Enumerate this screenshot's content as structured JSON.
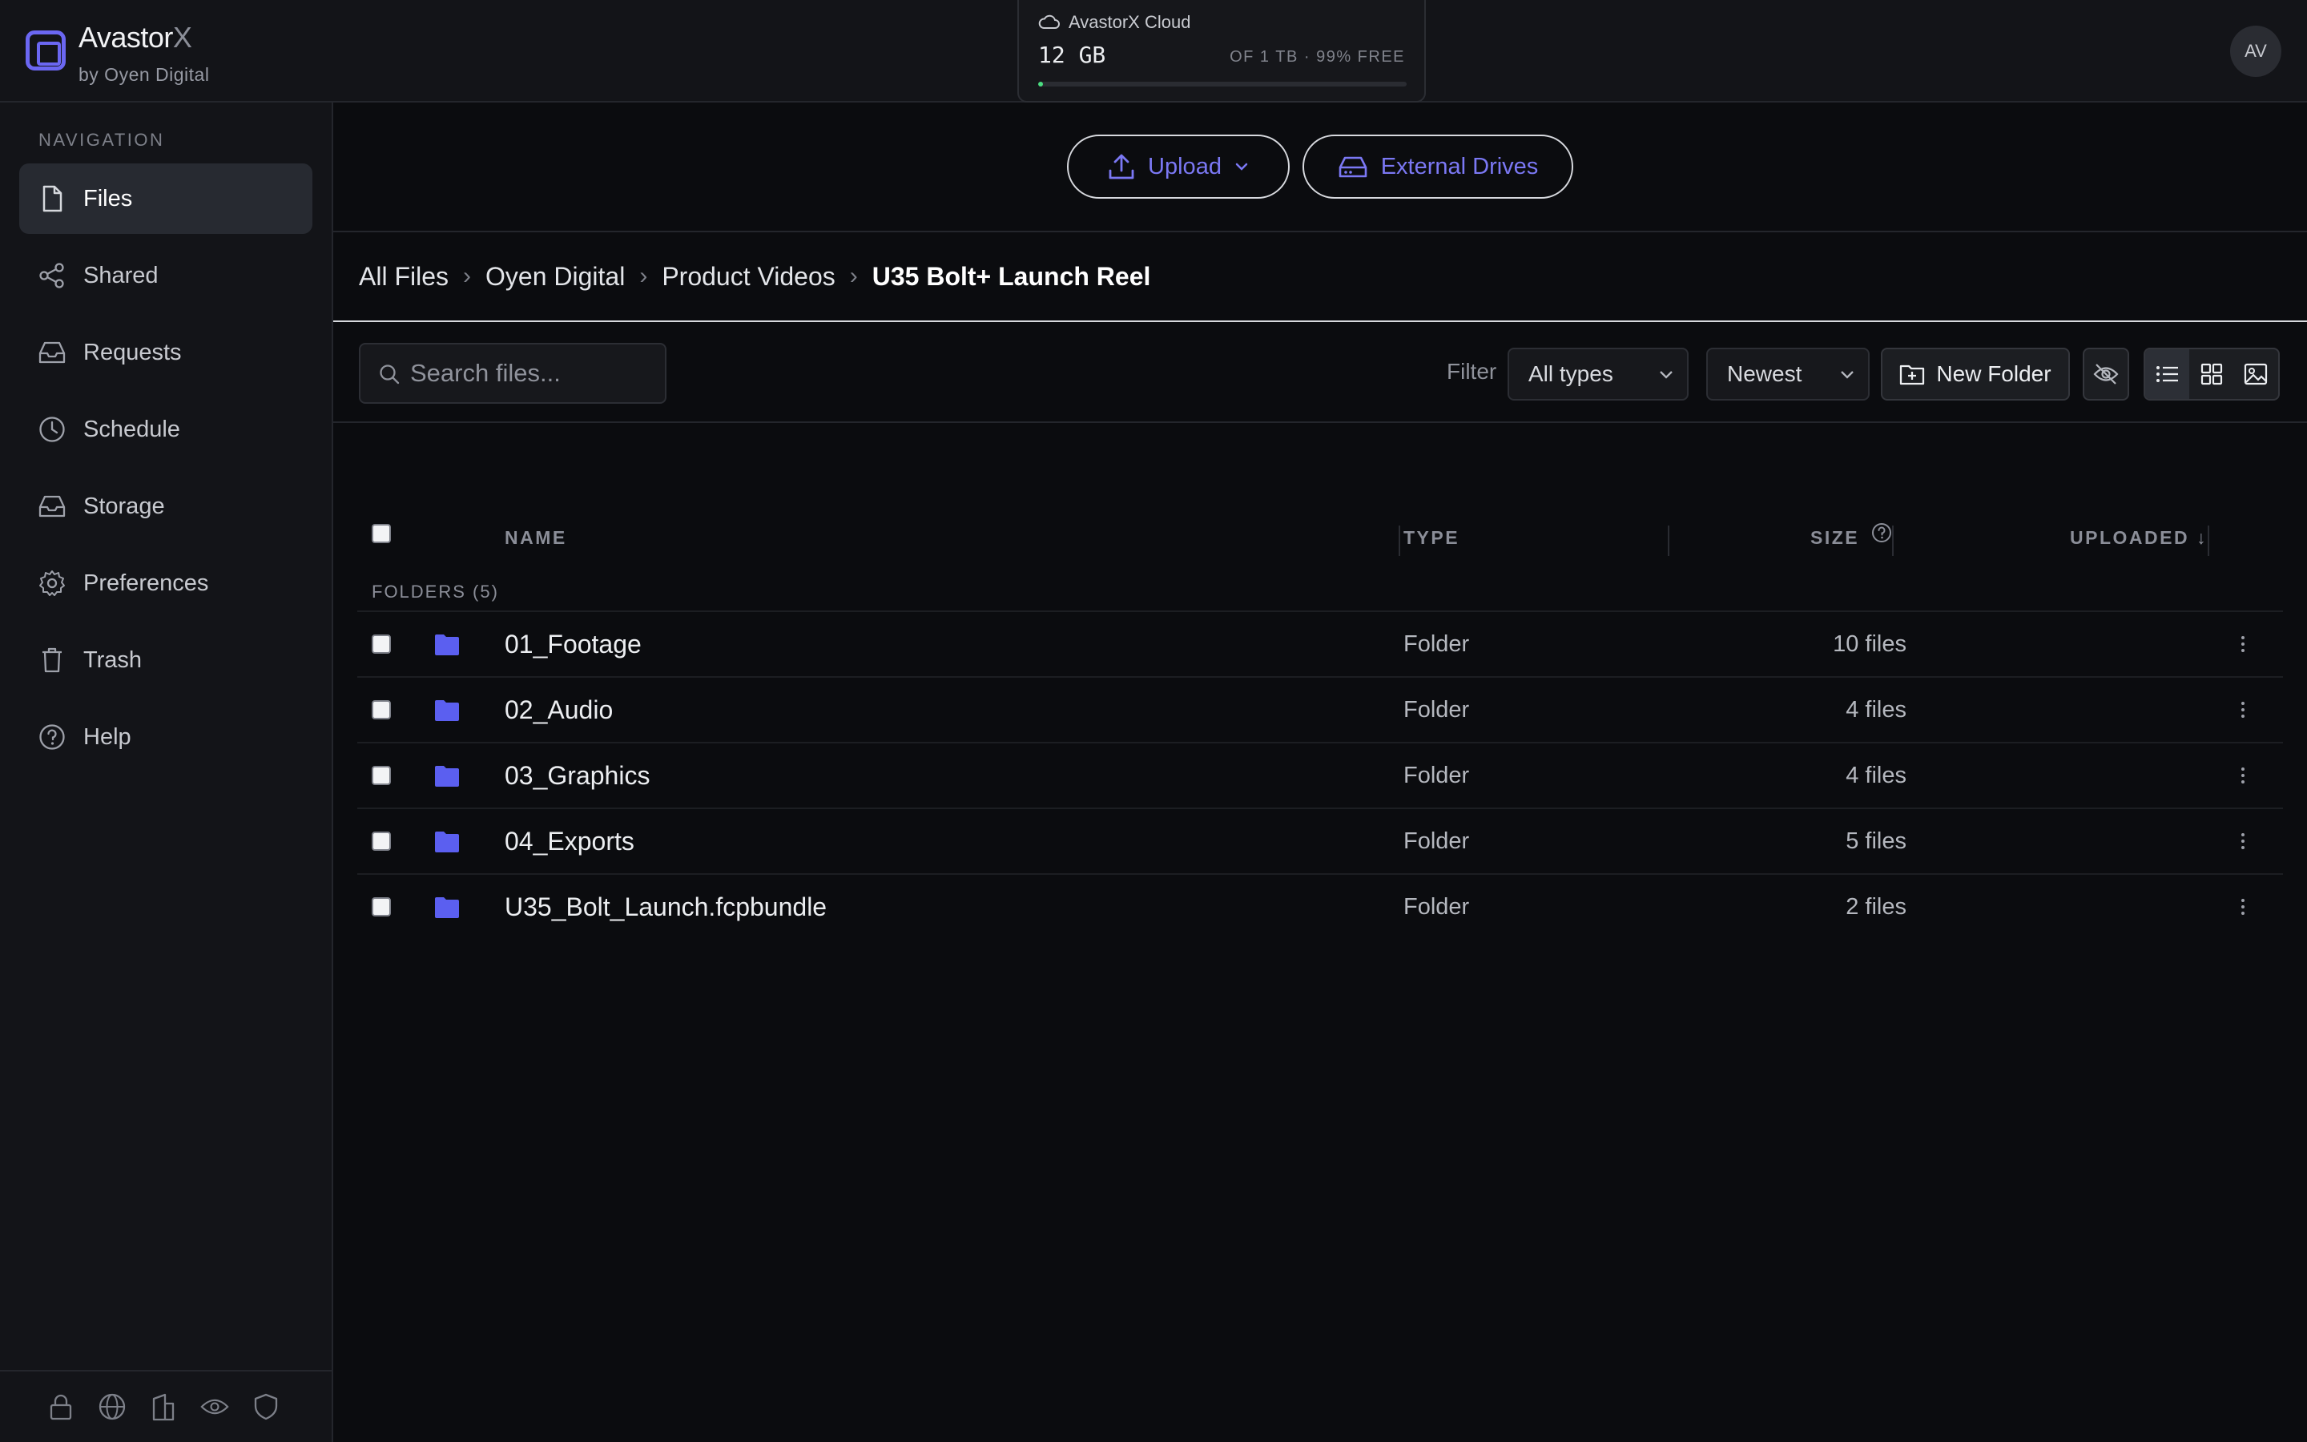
{
  "app": {
    "brand_name": "Avastor",
    "brand_name_x": "X",
    "brand_sub": "by Oyen Digital",
    "avatar_initials": "AV"
  },
  "cloud": {
    "title": "AvastorX Cloud",
    "used": "12 GB",
    "quota": "OF 1 TB · 99% FREE",
    "used_fraction": 0.012,
    "bar_color": "#4ade80"
  },
  "sidebar": {
    "heading": "NAVIGATION",
    "items": [
      {
        "label": "Files",
        "icon": "file-icon",
        "active": true
      },
      {
        "label": "Shared",
        "icon": "share-icon"
      },
      {
        "label": "Requests",
        "icon": "inbox-icon"
      },
      {
        "label": "Schedule",
        "icon": "clock-icon"
      },
      {
        "label": "Storage",
        "icon": "storage-icon"
      },
      {
        "label": "Preferences",
        "icon": "gear-icon"
      },
      {
        "label": "Trash",
        "icon": "trash-icon"
      },
      {
        "label": "Help",
        "icon": "help-icon"
      }
    ],
    "footer_icons": [
      "lock-icon",
      "globe-icon",
      "building-icon",
      "eye-icon",
      "shield-icon"
    ]
  },
  "actions": {
    "upload_label": "Upload",
    "external_drives_label": "External Drives"
  },
  "breadcrumb": [
    "All Files",
    "Oyen Digital",
    "Product Videos",
    "U35 Bolt+ Launch Reel"
  ],
  "toolbar": {
    "search_placeholder": "Search files...",
    "filter_label": "Filter",
    "type_filter_value": "All types",
    "sort_value": "Newest",
    "new_folder_label": "New Folder"
  },
  "table": {
    "columns": {
      "name": "NAME",
      "type": "TYPE",
      "size": "SIZE",
      "uploaded": "UPLOADED ↓"
    },
    "group_label": "FOLDERS (5)",
    "rows": [
      {
        "name": "01_Footage",
        "type": "Folder",
        "size": "10 files"
      },
      {
        "name": "02_Audio",
        "type": "Folder",
        "size": "4 files"
      },
      {
        "name": "03_Graphics",
        "type": "Folder",
        "size": "4 files"
      },
      {
        "name": "04_Exports",
        "type": "Folder",
        "size": "5 files"
      },
      {
        "name": "U35_Bolt_Launch.fcpbundle",
        "type": "Folder",
        "size": "2 files"
      }
    ]
  },
  "colors": {
    "accent": "#6b67f2",
    "folder": "#5b5ff0"
  }
}
